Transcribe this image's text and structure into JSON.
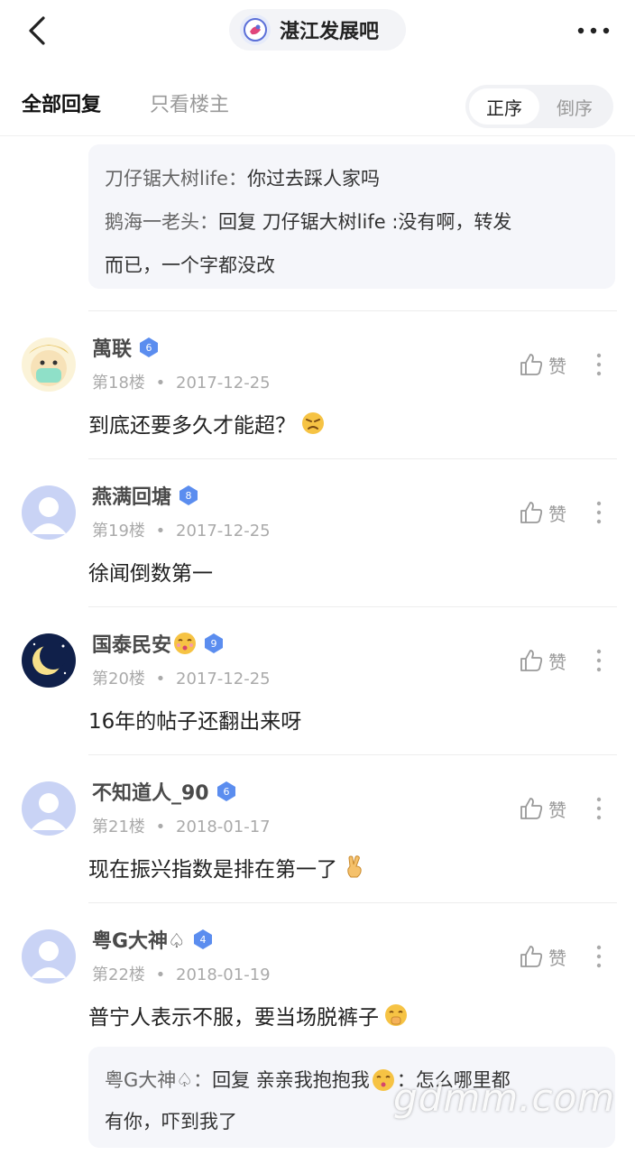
{
  "header": {
    "forum_name": "湛江发展吧",
    "icons": {
      "back": "back-chevron-icon",
      "more": "more-dots-icon",
      "forum_logo": "forum-logo-icon"
    }
  },
  "tabs": {
    "all": "全部回复",
    "owner_only": "只看楼主",
    "sort_asc": "正序",
    "sort_desc": "倒序",
    "active_sort": "正序"
  },
  "top_reply": {
    "line1_name": "刀仔锯大树life：",
    "line1_text": "你过去踩人家吗",
    "line2_name": "鹅海一老头：",
    "line2_text": "回复 刀仔锯大树life :没有啊，转发",
    "line3_text": "而已，一个字都没改"
  },
  "comments": [
    {
      "user": "萬联",
      "level": "6",
      "floor": "第18楼",
      "date": "2017-12-25",
      "text": "到底还要多久才能超？",
      "like": "赞",
      "emoji": "angry-emoji-icon"
    },
    {
      "user": "燕满回塘",
      "level": "8",
      "floor": "第19楼",
      "date": "2017-12-25",
      "text": "徐闻倒数第一",
      "like": "赞"
    },
    {
      "user": "国泰民安",
      "level": "9",
      "floor": "第20楼",
      "date": "2017-12-25",
      "text": "16年的帖子还翻出来呀",
      "like": "赞",
      "name_emoji": "kiss-emoji-icon"
    },
    {
      "user": "不知道人_90",
      "level": "6",
      "floor": "第21楼",
      "date": "2018-01-17",
      "text": "现在振兴指数是排在第一了",
      "like": "赞",
      "emoji": "victory-hand-icon"
    },
    {
      "user": "粤G大神♤",
      "level": "4",
      "floor": "第22楼",
      "date": "2018-01-19",
      "text": "普宁人表示不服，要当场脱裤子",
      "like": "赞",
      "emoji": "shy-emoji-icon"
    }
  ],
  "bottom_reply": {
    "name": "粤G大神♤：",
    "prefix": "回复 亲亲我抱抱我",
    "suffix": "：怎么哪里都",
    "line2": "有你，吓到我了"
  },
  "meta_separator": "•",
  "watermark": "gdmm.com",
  "colors": {
    "level_badge": "#5b8def",
    "accent_text": "#222222",
    "muted": "#999999"
  }
}
